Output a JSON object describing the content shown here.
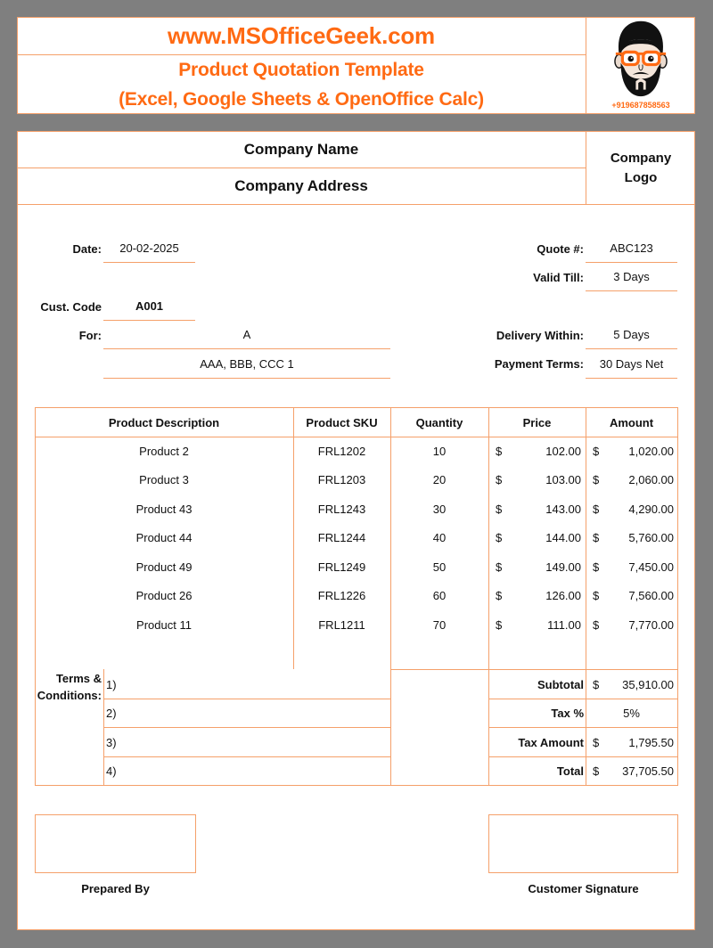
{
  "header": {
    "website": "www.MSOfficeGeek.com",
    "title": "Product Quotation Template",
    "subtitle": "(Excel, Google Sheets & OpenOffice Calc)",
    "phone": "+919687858563",
    "avatar_icon": "bearded-man-with-glasses"
  },
  "company": {
    "name": "Company Name",
    "address": "Company Address",
    "logo_placeholder": "Company Logo"
  },
  "info": {
    "date": {
      "label": "Date:",
      "value": "20-02-2025"
    },
    "customer_code": {
      "label": "Cust. Code",
      "value": "A001"
    },
    "for": {
      "label": "For:",
      "name": "A",
      "address": "AAA, BBB, CCC 1"
    },
    "quote_number": {
      "label": "Quote #:",
      "value": "ABC123"
    },
    "valid_till": {
      "label": "Valid Till:",
      "value": "3 Days"
    },
    "delivery_within": {
      "label": "Delivery Within:",
      "value": "5 Days"
    },
    "payment_terms": {
      "label": "Payment Terms:",
      "value": "30 Days Net"
    }
  },
  "table": {
    "headers": {
      "description": "Product Description",
      "sku": "Product SKU",
      "quantity": "Quantity",
      "price": "Price",
      "amount": "Amount"
    },
    "currency_symbol": "$",
    "rows": [
      {
        "description": "Product 2",
        "sku": "FRL1202",
        "quantity": "10",
        "price": "102.00",
        "amount": "1,020.00"
      },
      {
        "description": "Product 3",
        "sku": "FRL1203",
        "quantity": "20",
        "price": "103.00",
        "amount": "2,060.00"
      },
      {
        "description": "Product 43",
        "sku": "FRL1243",
        "quantity": "30",
        "price": "143.00",
        "amount": "4,290.00"
      },
      {
        "description": "Product 44",
        "sku": "FRL1244",
        "quantity": "40",
        "price": "144.00",
        "amount": "5,760.00"
      },
      {
        "description": "Product 49",
        "sku": "FRL1249",
        "quantity": "50",
        "price": "149.00",
        "amount": "7,450.00"
      },
      {
        "description": "Product 26",
        "sku": "FRL1226",
        "quantity": "60",
        "price": "126.00",
        "amount": "7,560.00"
      },
      {
        "description": "Product 11",
        "sku": "FRL1211",
        "quantity": "70",
        "price": "111.00",
        "amount": "7,770.00"
      }
    ]
  },
  "terms": {
    "label": "Terms & Conditions:",
    "items": [
      "1)",
      "2)",
      "3)",
      "4)"
    ]
  },
  "totals": {
    "subtotal": {
      "label": "Subtotal",
      "value": "35,910.00"
    },
    "tax_percent": {
      "label": "Tax %",
      "value": "5%"
    },
    "tax_amount": {
      "label": "Tax Amount",
      "value": "1,795.50"
    },
    "total": {
      "label": "Total",
      "value": "37,705.50"
    }
  },
  "signatures": {
    "prepared_by": "Prepared By",
    "customer_signature": "Customer Signature"
  },
  "colors": {
    "accent": "#ff6a13",
    "border": "#f5a06a",
    "background": "#7f7f7f",
    "paper": "#ffffff"
  }
}
